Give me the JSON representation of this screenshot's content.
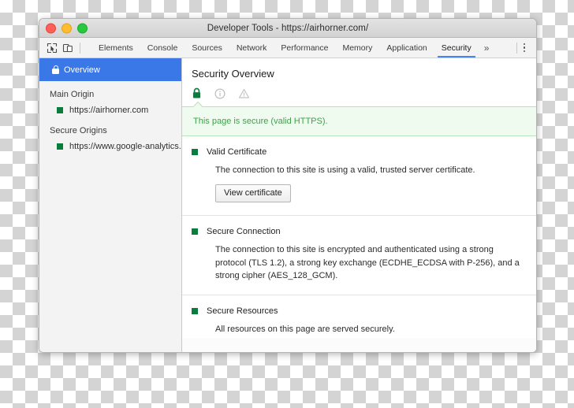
{
  "window": {
    "title": "Developer Tools - https://airhorner.com/",
    "controls": [
      "close",
      "minimize",
      "maximize"
    ]
  },
  "toolbar": {
    "inspect_icon": "inspect-cursor-icon",
    "device_icon": "device-toolbar-icon",
    "more_tabs_label": "»",
    "menu_icon": "kebab-menu-icon",
    "tabs": [
      {
        "label": "Elements",
        "active": false
      },
      {
        "label": "Console",
        "active": false
      },
      {
        "label": "Sources",
        "active": false
      },
      {
        "label": "Network",
        "active": false
      },
      {
        "label": "Performance",
        "active": false
      },
      {
        "label": "Memory",
        "active": false
      },
      {
        "label": "Application",
        "active": false
      },
      {
        "label": "Security",
        "active": true
      }
    ]
  },
  "sidebar": {
    "overview": {
      "label": "Overview",
      "icon": "lock-icon",
      "selected": true
    },
    "groups": [
      {
        "label": "Main Origin",
        "origins": [
          {
            "label": "https://airhorner.com",
            "state": "secure"
          }
        ]
      },
      {
        "label": "Secure Origins",
        "origins": [
          {
            "label": "https://www.google-analytics.co",
            "state": "secure"
          }
        ]
      }
    ]
  },
  "main": {
    "title": "Security Overview",
    "state_icons": [
      {
        "name": "lock-icon",
        "state": "active"
      },
      {
        "name": "info-icon",
        "state": "inactive"
      },
      {
        "name": "warning-triangle-icon",
        "state": "inactive"
      }
    ],
    "banner": {
      "text": "This page is secure (valid HTTPS).",
      "tone": "secure"
    },
    "sections": [
      {
        "title": "Valid Certificate",
        "state": "secure",
        "text": "The connection to this site is using a valid, trusted server certificate.",
        "button": "View certificate"
      },
      {
        "title": "Secure Connection",
        "state": "secure",
        "text": "The connection to this site is encrypted and authenticated using a strong protocol (TLS 1.2), a strong key exchange (ECDHE_ECDSA with P-256), and a strong cipher (AES_128_GCM)."
      },
      {
        "title": "Secure Resources",
        "state": "secure",
        "text": "All resources on this page are served securely."
      }
    ]
  },
  "colors": {
    "accent_blue": "#3b78e7",
    "tab_underline": "#4285f4",
    "secure_green": "#0a7d3e",
    "banner_bg": "#effbef",
    "banner_text": "#3fa14a",
    "banner_border": "#b8e3b8",
    "titlebar": "#d8d8d8",
    "sidebar_bg": "#f3f3f3"
  }
}
